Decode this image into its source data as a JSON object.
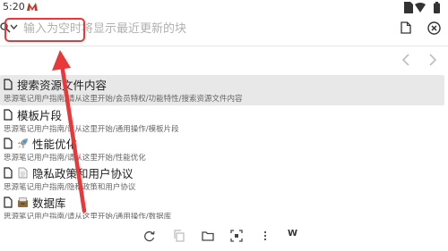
{
  "status": {
    "time": "5:20"
  },
  "search": {
    "placeholder": "输入为空时将显示最近更新的块",
    "value": ""
  },
  "results": [
    {
      "title": "搜索资源文件内容",
      "path": "思源笔记用户指南/请从这里开始/会员特权/功能特性/搜索资源文件内容",
      "emoji": "",
      "selected": true
    },
    {
      "title": "模板片段",
      "path": "思源笔记用户指南/请从这里开始/通用操作/模板片段",
      "emoji": "",
      "selected": false
    },
    {
      "title": "性能优化",
      "path": "思源笔记用户指南/请从这里开始/性能优化",
      "emoji": "rocket-icon",
      "selected": false
    },
    {
      "title": "隐私政策和用户协议",
      "path": "思源笔记用户指南/隐私政策和用户协议",
      "emoji": "page-icon",
      "selected": false
    },
    {
      "title": "数据库",
      "path": "思源笔记用户指南/请从这里开始/通用操作/数据库",
      "emoji": "card-box-icon",
      "selected": false
    }
  ],
  "toolbar": {
    "w_label": "W"
  },
  "colors": {
    "annotation": "#e8383a",
    "selected_bg": "#e8e8e8"
  }
}
